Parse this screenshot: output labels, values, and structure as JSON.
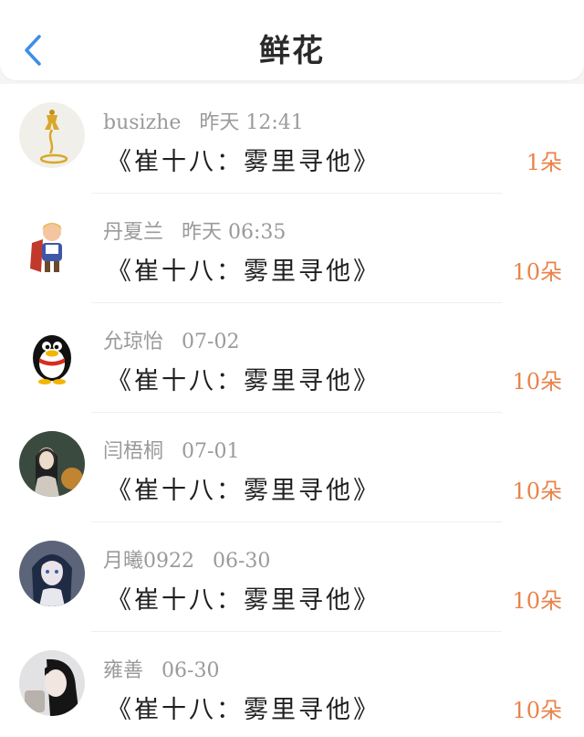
{
  "header": {
    "title": "鲜花",
    "back_icon": "chevron-left-icon",
    "accent_color": "#3d8ee8"
  },
  "colors": {
    "count": "#e8834a",
    "meta": "#9a9a9a",
    "text": "#1f1f1f"
  },
  "items": [
    {
      "user": "busizhe",
      "time": "昨天 12:41",
      "book": "《崔十八：雾里寻他》",
      "count": "1朵",
      "avatar": "gold-figure-avatar"
    },
    {
      "user": "丹夏兰",
      "time": "昨天 06:35",
      "book": "《崔十八：雾里寻他》",
      "count": "10朵",
      "avatar": "cartoon-prince-avatar"
    },
    {
      "user": "允琼怡",
      "time": "07-02",
      "book": "《崔十八：雾里寻他》",
      "count": "10朵",
      "avatar": "qq-penguin-avatar"
    },
    {
      "user": "闫梧桐",
      "time": "07-01",
      "book": "《崔十八：雾里寻他》",
      "count": "10朵",
      "avatar": "girl-photo-avatar"
    },
    {
      "user": "月曦0922",
      "time": "06-30",
      "book": "《崔十八：雾里寻他》",
      "count": "10朵",
      "avatar": "anime-girl-avatar"
    },
    {
      "user": "雍善",
      "time": "06-30",
      "book": "《崔十八：雾里寻他》",
      "count": "10朵",
      "avatar": "woman-photo-avatar"
    }
  ]
}
